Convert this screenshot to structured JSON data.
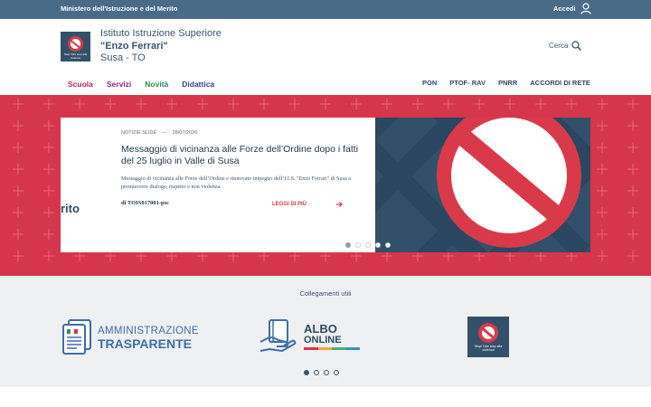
{
  "topbar": {
    "ministry": "Ministero dell'Istruzione e del Merito",
    "login_label": "Accedi",
    "icon": "user-icon"
  },
  "header": {
    "logo_text": "Stop! Dire stop alla violenza",
    "school_line1": "Istituto Istruzione Superiore",
    "school_line2": "\"Enzo Ferrari\"",
    "school_line3": "Susa - TO",
    "search_label": "Cerca",
    "search_icon": "search-icon"
  },
  "nav": {
    "left": [
      {
        "label": "Scuola",
        "color": "#b5294e"
      },
      {
        "label": "Servizi",
        "color": "#8a2a8a"
      },
      {
        "label": "Novità",
        "color": "#2e8a55"
      },
      {
        "label": "Didattica",
        "color": "#2b3f9a"
      }
    ],
    "right": [
      "PON",
      "PTOF- RAV",
      "PNRR",
      "ACCORDI DI RETE"
    ]
  },
  "hero": {
    "bg_color": "#d6364b",
    "side_text": "rito",
    "category": "NOTIZIE SLIDE",
    "separator": "—",
    "date": "28/07/2026",
    "title": "Messaggio di vicinanza alle Forze dell’Ordine dopo i fatti del 25 luglio in Valle di Susa",
    "description": "Messaggio di vicinanza alle Forze dell’Ordine e rinnovato impegno dell’I.I.S. \"Enzo Ferrari\" di Susa a promuovere dialogo, rispetto e non violenza.",
    "author": "di TOIS017001-psc",
    "read_more": "LEGGI DI PIÙ",
    "slides_total": 5,
    "slide_active": 1
  },
  "links": {
    "label": "Collegamenti utili",
    "amm_line1": "AMMINISTRAZIONE",
    "amm_line2": "TRASPARENTE",
    "albo_line1": "ALBO",
    "albo_line2": "ONLINE",
    "albo_bar_colors": [
      "#d6364b",
      "#f2a541",
      "#49b06b",
      "#3d8ed0"
    ],
    "logo_text": "Stop! Dire stop alla violenza",
    "pages_total": 4,
    "page_active": 1
  }
}
